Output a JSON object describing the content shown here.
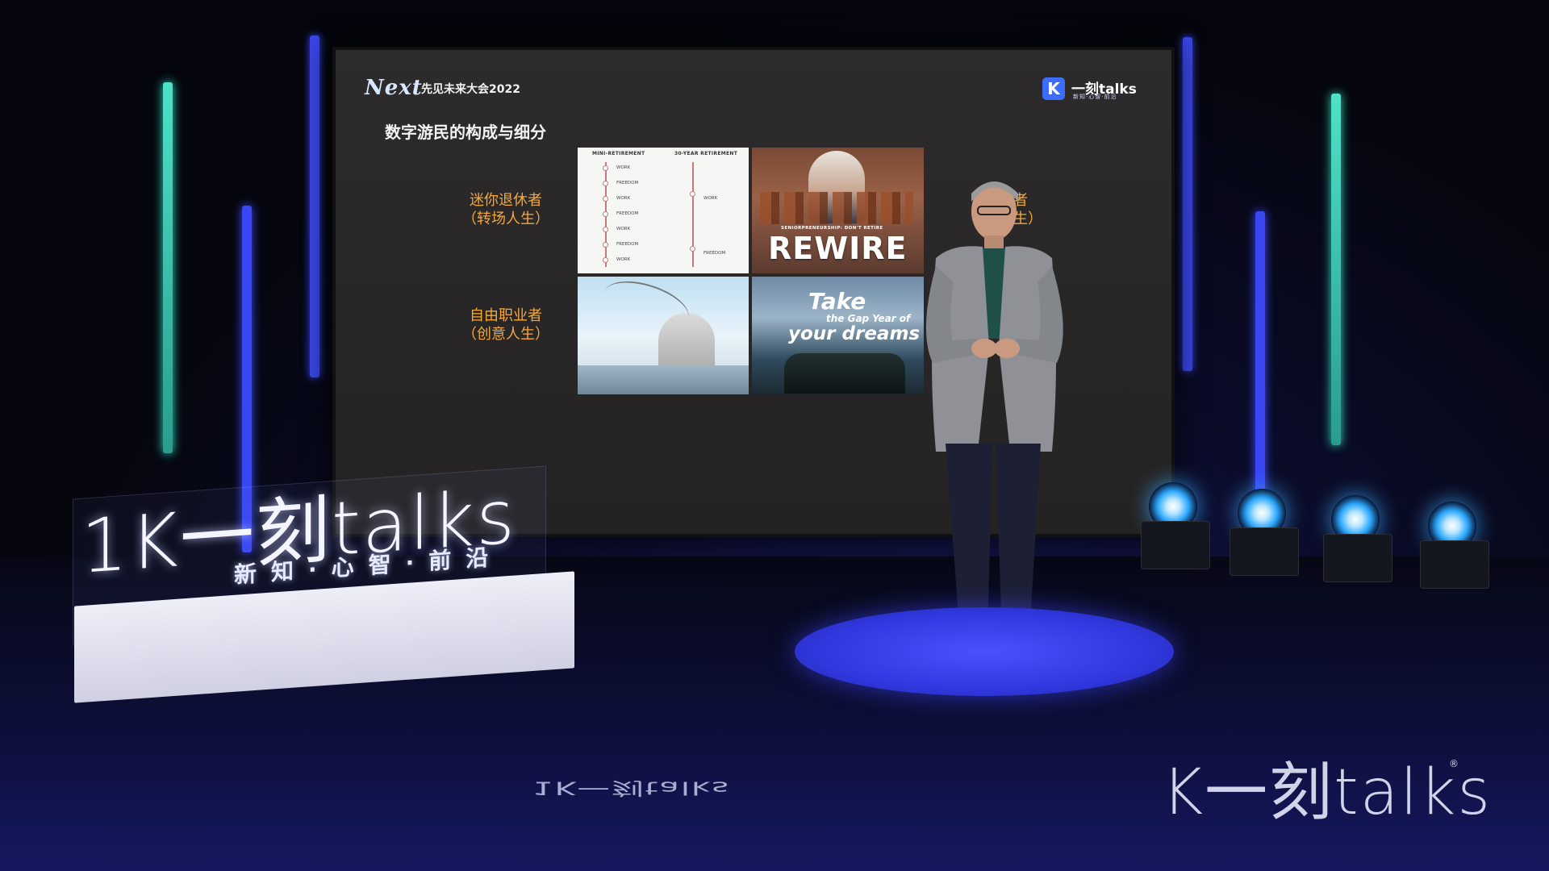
{
  "slide": {
    "event_logo_word": "Next",
    "event_title": "先见未来大会2022",
    "brand_name": "一刻talks",
    "brand_sub": "新知·心智·前沿",
    "brand_k": "K",
    "title": "数字游民的构成与细分",
    "labels": {
      "mini_retiree_line1": "迷你退休者",
      "mini_retiree_line2": "（转场人生）",
      "freelancer_line1": "自由职业者",
      "freelancer_line2": "（创意人生）",
      "right_partial_line1": "业者",
      "right_partial_line2": "人生）"
    },
    "chart": {
      "col1_header": "MINI-RETIREMENT",
      "col2_header": "30-YEAR RETIREMENT",
      "col1_items": [
        "WORK",
        "FREEDOM",
        "WORK",
        "FREEDOM",
        "WORK",
        "FREEDOM",
        "WORK"
      ],
      "col2_items": [
        "WORK",
        "FREEDOM"
      ]
    },
    "rewire": {
      "small_text": "SENIORPRENEURSHIP: DON'T RETIRE",
      "big_text": "REWIRE"
    },
    "gap_year": {
      "line1": "Take",
      "line2": "the Gap Year of",
      "line3": "your dreams"
    }
  },
  "stage": {
    "sign_logo": "1K一刻talks",
    "sign_slogan": "新知·心智·前沿",
    "floor_logo": "1K一刻talks",
    "watermark": "K一刻talks",
    "watermark_reg": "®"
  },
  "colors": {
    "accent_orange": "#f6a83a",
    "led_teal": "#3fc9b8",
    "led_blue": "#3a4cff",
    "rug_blue": "#3a40ff"
  }
}
